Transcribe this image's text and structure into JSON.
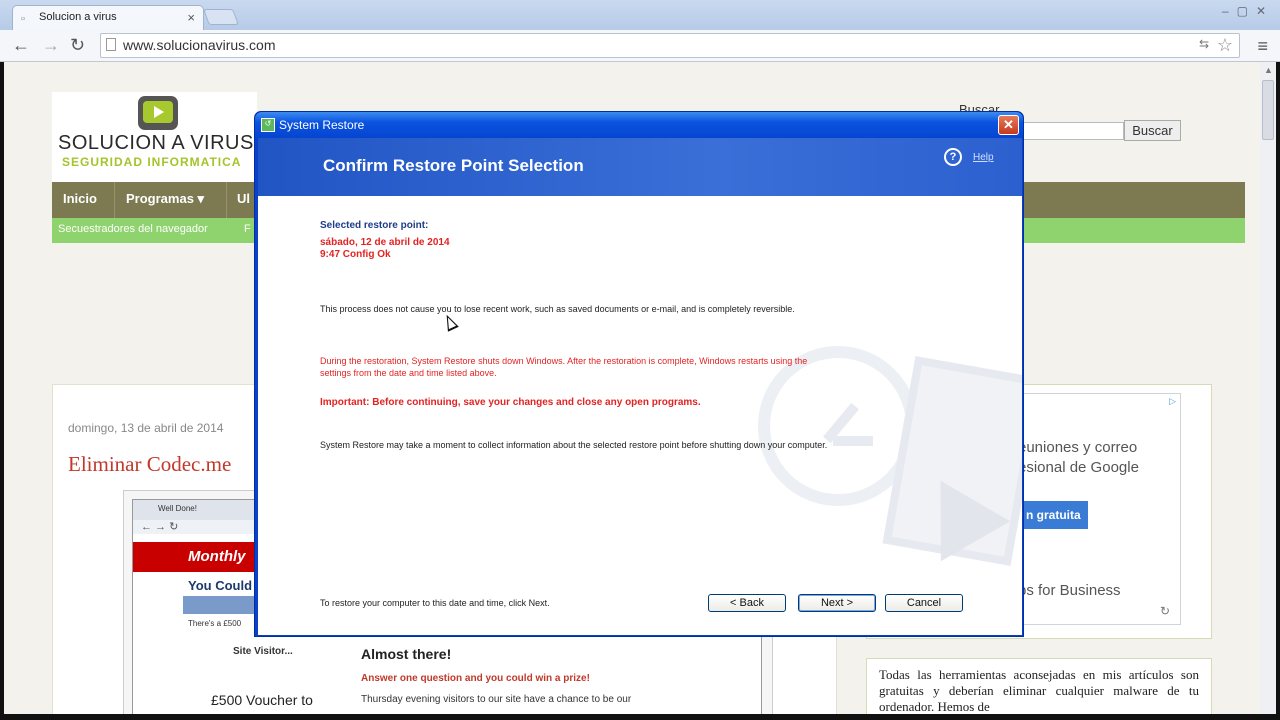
{
  "browser": {
    "tab_title": "Solucion a virus",
    "tab_close": "×",
    "url": "www.solucionavirus.com",
    "window_controls": [
      "–",
      "▢",
      "✕"
    ]
  },
  "site": {
    "logo_title": "SOLUCION A VIRUS",
    "logo_subtitle": "SEGURIDAD INFORMATICA",
    "search_label": "Buscar",
    "search_button": "Buscar",
    "nav_items": [
      "Inicio",
      "Programas ▾",
      "Ul"
    ],
    "subnav_items": [
      "Secuestradores del navegador",
      "F"
    ],
    "post_date": "domingo, 13 de abril de 2014",
    "post_title": "Eliminar Codec.me",
    "inner_tab": "Well Done!",
    "inner_monthly": "Monthly",
    "inner_you_could": "You Could",
    "inner_theres": "There's a £500",
    "inner_site_visitor": "Site Visitor...",
    "inner_almost": "Almost there!",
    "inner_answer": "Answer one question and you could win a prize!",
    "inner_voucher": "£500 Voucher to",
    "inner_thursday": "Thursday evening visitors to our site have a chance to be our",
    "ad_line1": "euniones y correo",
    "ad_line2": "esional de Google",
    "ad_button": "n gratuita",
    "ad_line3": "ps for Business",
    "side_text": "Todas las herramientas aconsejadas en mis artículos son gratuitas y deberían eliminar cualquier malware de tu ordenador. Hemos de"
  },
  "dialog": {
    "window_title": "System Restore",
    "header_title": "Confirm Restore Point Selection",
    "help_label": "Help",
    "selected_label": "Selected restore point:",
    "selected_date": "sábado, 12 de abril de 2014",
    "selected_desc": "9:47 Config Ok",
    "para1": "This process does not cause you to lose recent work, such as saved documents or e-mail, and is completely reversible.",
    "para2": "During the restoration, System Restore shuts down Windows. After the restoration is complete, Windows restarts using the settings from the date and time listed above.",
    "para3": "Important: Before continuing, save your changes and close any open programs.",
    "para4": "System Restore may take a moment to collect information about the selected restore point before shutting down your computer.",
    "footer": "To restore your computer to this date and time, click Next.",
    "back_button": "< Back",
    "next_button": "Next >",
    "cancel_button": "Cancel"
  }
}
